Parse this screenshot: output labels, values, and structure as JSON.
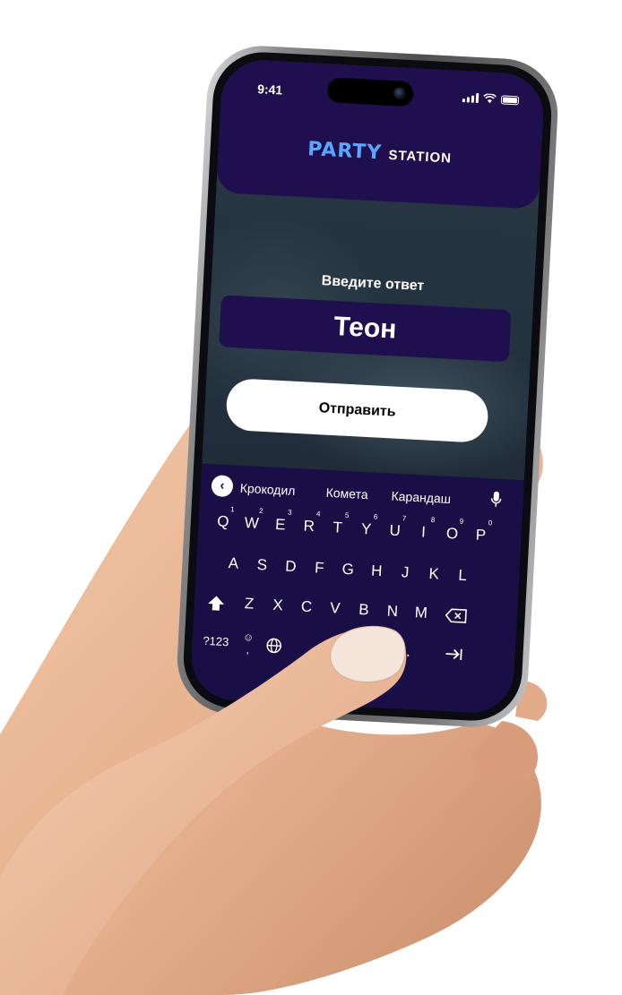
{
  "status_bar": {
    "time": "9:41"
  },
  "header": {
    "logo_party": "PARTY",
    "logo_station": "STATION"
  },
  "prompt": {
    "label": "Введите ответ"
  },
  "answer": {
    "value": "Теон"
  },
  "submit": {
    "label": "Отправить"
  },
  "keyboard": {
    "back_icon": "chevron-left-icon",
    "suggestions": [
      "Крокодил",
      "Комета",
      "Карандаш"
    ],
    "row1": [
      {
        "key": "Q",
        "num": "1"
      },
      {
        "key": "W",
        "num": "2"
      },
      {
        "key": "E",
        "num": "3"
      },
      {
        "key": "R",
        "num": "4"
      },
      {
        "key": "T",
        "num": "5"
      },
      {
        "key": "Y",
        "num": "6"
      },
      {
        "key": "U",
        "num": "7"
      },
      {
        "key": "I",
        "num": "8"
      },
      {
        "key": "O",
        "num": "9"
      },
      {
        "key": "P",
        "num": "0"
      }
    ],
    "row2": [
      "A",
      "S",
      "D",
      "F",
      "G",
      "H",
      "J",
      "K",
      "L"
    ],
    "row3": [
      "Z",
      "X",
      "C",
      "V",
      "B",
      "N",
      "M"
    ],
    "symbols_key": "?123",
    "comma_key": ",",
    "period_key": ".",
    "emoji_icon": "emoji-icon",
    "globe_icon": "globe-icon",
    "shift_icon": "shift-icon",
    "backspace_icon": "backspace-icon",
    "enter_icon": "tab-arrow-icon",
    "mic_icon": "mic-icon"
  },
  "colors": {
    "header_bg": "#200f4f",
    "keyboard_bg": "#1a0e46",
    "logo_accent": "#5aa6ff",
    "button_bg": "#ffffff"
  }
}
